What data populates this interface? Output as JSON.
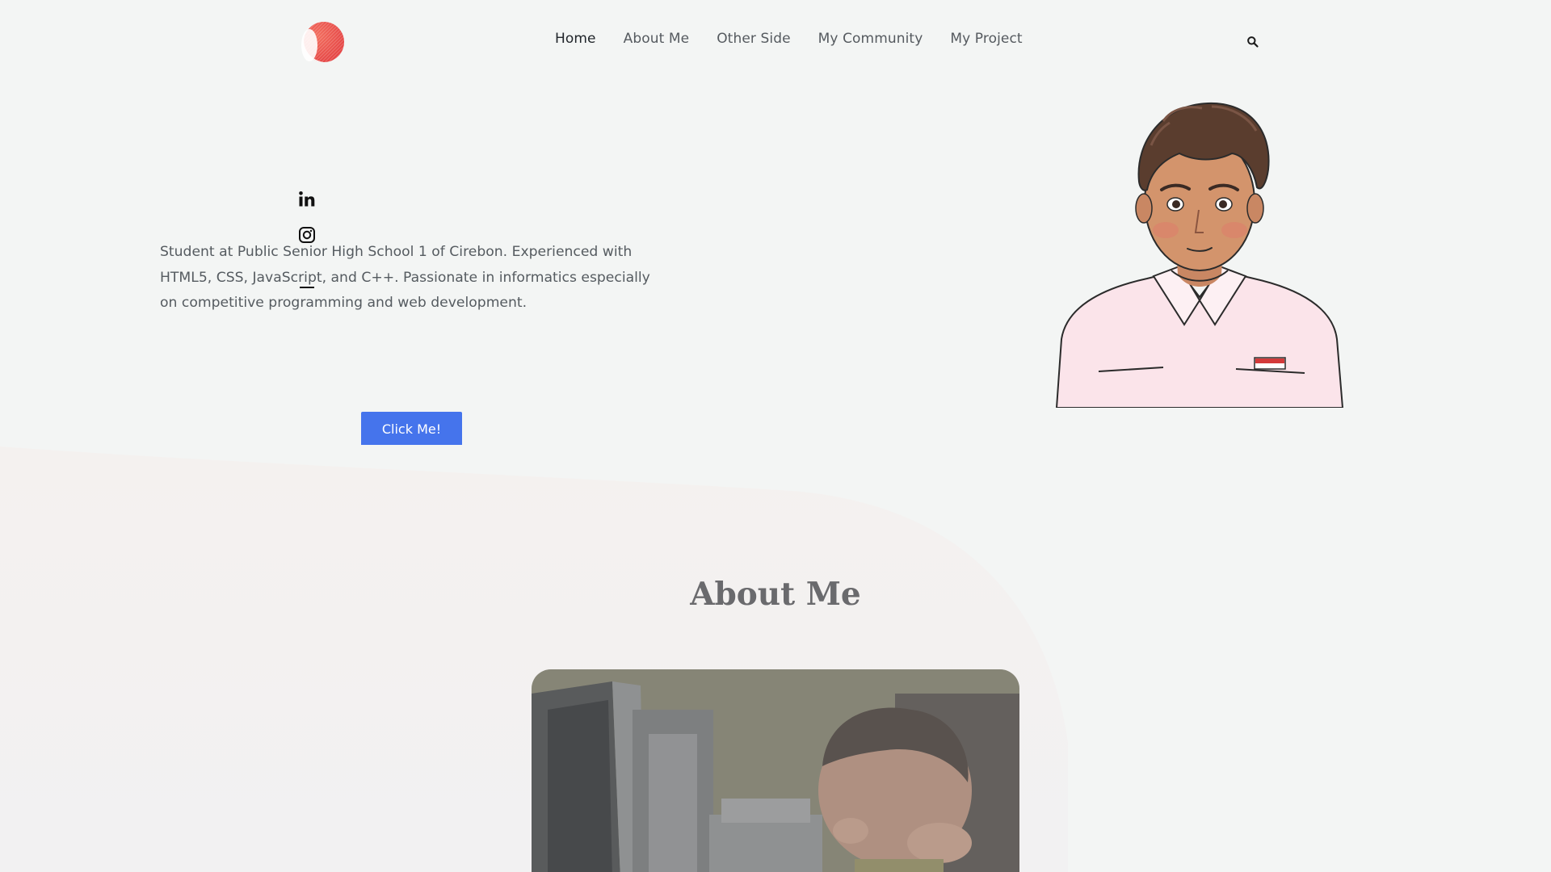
{
  "nav": {
    "items": [
      {
        "label": "Home",
        "active": true
      },
      {
        "label": "About Me",
        "active": false
      },
      {
        "label": "Other Side",
        "active": false
      },
      {
        "label": "My Community",
        "active": false
      },
      {
        "label": "My Project",
        "active": false
      }
    ]
  },
  "hero": {
    "bio": "Student at Public Senior High School 1 of Cirebon. Experienced with HTML5, CSS, JavaScript, and C++. Passionate in informatics especially on competitive programming and web development.",
    "cta_label": "Click Me!",
    "socials": [
      "linkedin-icon",
      "instagram-icon"
    ]
  },
  "about": {
    "title": "About Me"
  },
  "colors": {
    "accent": "#4574ec",
    "logo": "#ec4b49",
    "background": "#f3f5f4"
  }
}
